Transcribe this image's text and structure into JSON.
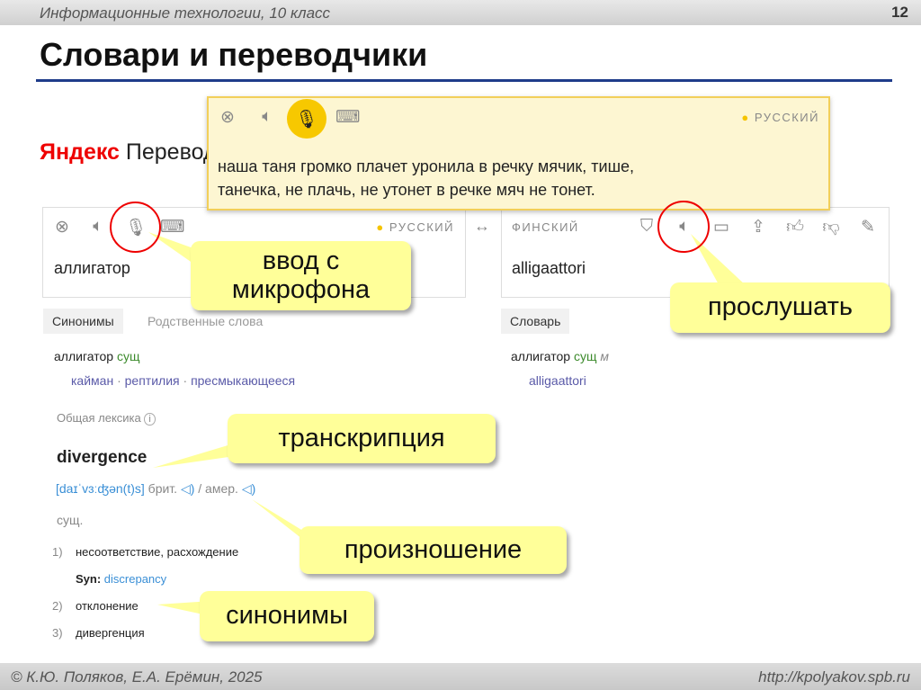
{
  "header": {
    "course": "Информационные технологии, 10 класс",
    "page": "12"
  },
  "title": "Словари и переводчики",
  "logo": {
    "brand": "Яндекс",
    "product": "Переводчик"
  },
  "overlay": {
    "lang": "РУССКИЙ",
    "text_line1": "наша таня громко плачет уронила в речку мячик, тише,",
    "text_line2": "танечка, не плачь, не утонет в речке мяч не тонет."
  },
  "source": {
    "lang": "РУССКИЙ",
    "text": "аллигатор",
    "swap": "↔"
  },
  "target": {
    "lang": "ФИНСКИЙ",
    "text": "alligaattori"
  },
  "left_tabs": [
    "Синонимы",
    "Родственные слова"
  ],
  "right_tabs": [
    "Словарь"
  ],
  "synonyms": {
    "word": "аллигатор",
    "pos": "сущ",
    "items": [
      "кайман",
      "рептилия",
      "пресмыкающееся"
    ],
    "sep": "·"
  },
  "dictionary": {
    "word": "аллигатор",
    "pos": "сущ",
    "gender": "м",
    "translation": "alligaattori"
  },
  "lexicon": {
    "label": "Общая лексика",
    "info": "i",
    "headword": "divergence",
    "transcription": "[daɪˈvɜːʤən(t)s]",
    "brit": "брит.",
    "amer": "/ амер.",
    "pos": "сущ.",
    "senses": [
      {
        "num": "1)",
        "text": "несоответствие, расхождение"
      },
      {
        "num": "2)",
        "text": "отклонение"
      },
      {
        "num": "3)",
        "text": "дивергенция"
      }
    ],
    "syn_label": "Syn:",
    "syn_value": "discrepancy"
  },
  "callouts": {
    "mic": "ввод с микрофона",
    "listen": "прослушать",
    "transcription": "транскрипция",
    "pronunciation": "произношение",
    "synonyms": "синонимы"
  },
  "footer": {
    "authors": "© К.Ю. Поляков, Е.А. Ерёмин, 2025",
    "url": "http://kpolyakov.spb.ru"
  }
}
